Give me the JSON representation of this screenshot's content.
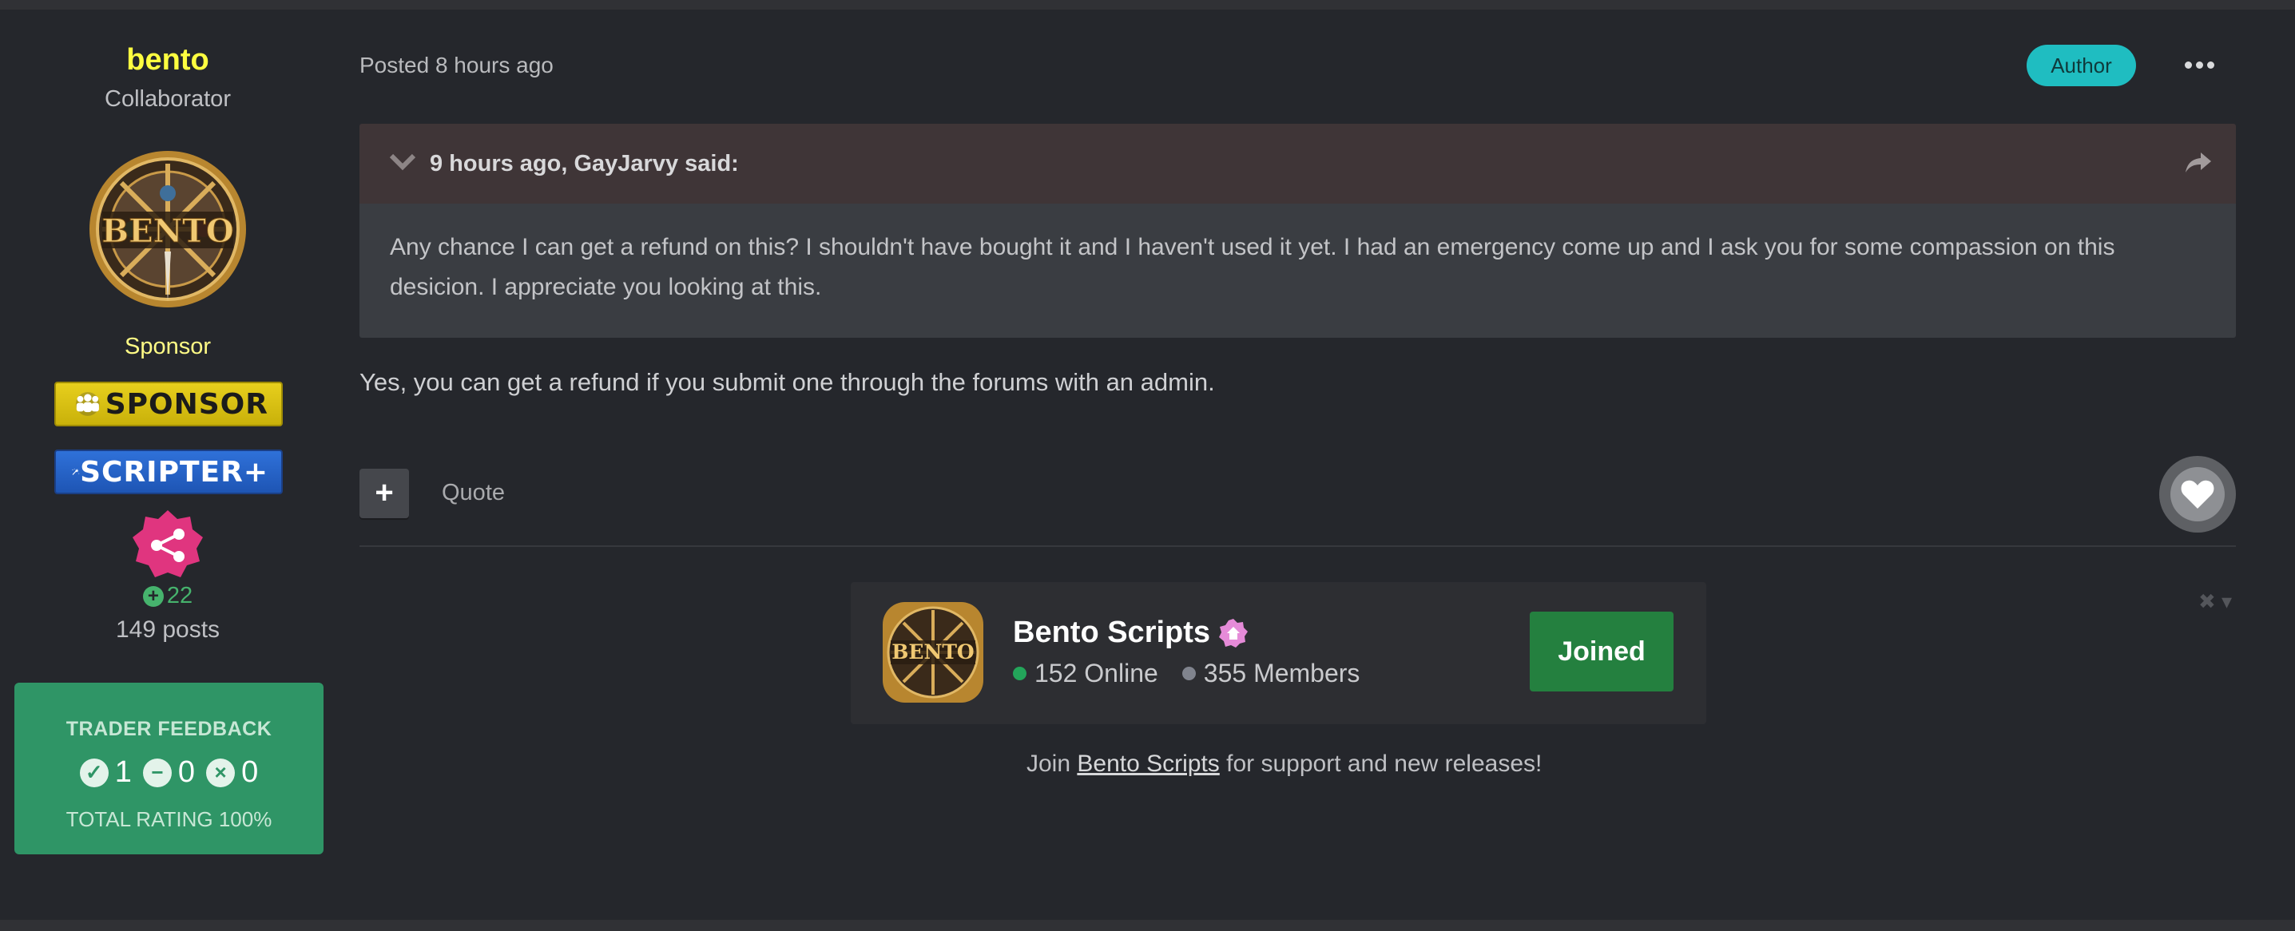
{
  "author": {
    "name": "bento",
    "title": "Collaborator",
    "group": "Sponsor",
    "badges": [
      {
        "label": "SPONSOR",
        "color": "#d8c214"
      },
      {
        "label": "SCRIPTER+",
        "color": "#2565c9"
      }
    ],
    "reputation": "22",
    "posts": "149 posts",
    "trader_feedback": {
      "title": "TRADER FEEDBACK",
      "positive": "1",
      "neutral": "0",
      "negative": "0",
      "total": "TOTAL RATING 100%"
    },
    "avatar_text": "BENTO"
  },
  "post": {
    "posted": "Posted 8 hours ago",
    "author_badge": "Author",
    "quote": {
      "citation": "9 hours ago, GayJarvy said:",
      "text": "Any chance I can get a refund on this? I shouldn't have bought it and I haven't used it yet.  I had an emergency come up and I ask you for some compassion on this desicion. I appreciate you looking at this."
    },
    "reply": "Yes, you can get a refund if you submit one through the forums with an admin.",
    "actions": {
      "plus": "+",
      "quote": "Quote"
    }
  },
  "signature": {
    "discord": {
      "server_name": "Bento Scripts",
      "online": "152 Online",
      "members": "355 Members",
      "button": "Joined",
      "online_color": "#23a55a",
      "members_color": "#80848e"
    },
    "join_prefix": "Join ",
    "join_link": "Bento Scripts",
    "join_suffix": " for support and new releases!"
  },
  "colors": {
    "username": "#ffff40",
    "author_pill": "#1fbdc1",
    "trader_green": "#2f9566",
    "quote_header": "#3f3537",
    "joined_button": "#24803f"
  }
}
